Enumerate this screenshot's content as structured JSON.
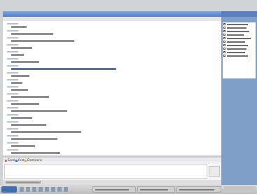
{
  "window": {
    "title": ""
  },
  "transcript": [
    {
      "sender": "",
      "text": "",
      "type": "text"
    },
    {
      "sender": "",
      "text": "",
      "type": "text"
    },
    {
      "sender": "",
      "text": "",
      "type": "text"
    },
    {
      "sender": "",
      "text": "",
      "type": "text"
    },
    {
      "sender": "",
      "text": "",
      "type": "text"
    },
    {
      "sender": "",
      "text": "",
      "type": "text"
    },
    {
      "sender": "",
      "text": "",
      "type": "link"
    },
    {
      "sender": "",
      "text": "",
      "type": "text"
    },
    {
      "sender": "",
      "text": "",
      "type": "text"
    },
    {
      "sender": "",
      "text": "",
      "type": "text"
    },
    {
      "sender": "",
      "text": "",
      "type": "text"
    },
    {
      "sender": "",
      "text": "",
      "type": "text"
    },
    {
      "sender": "",
      "text": "",
      "type": "text"
    },
    {
      "sender": "",
      "text": "",
      "type": "text"
    },
    {
      "sender": "",
      "text": "",
      "type": "text"
    },
    {
      "sender": "",
      "text": "",
      "type": "text"
    },
    {
      "sender": "",
      "text": "",
      "type": "text"
    },
    {
      "sender": "",
      "text": "",
      "type": "text"
    },
    {
      "sender": "",
      "text": "",
      "type": "text"
    }
  ],
  "input_toolbar": {
    "send_file": "Send",
    "font": "Font",
    "emoticons": "Emoticons"
  },
  "side_panel": {
    "title": "",
    "items": [
      "",
      "",
      "",
      "",
      "",
      "",
      "",
      "",
      "",
      ""
    ]
  },
  "taskbar": {
    "start_label": ""
  }
}
